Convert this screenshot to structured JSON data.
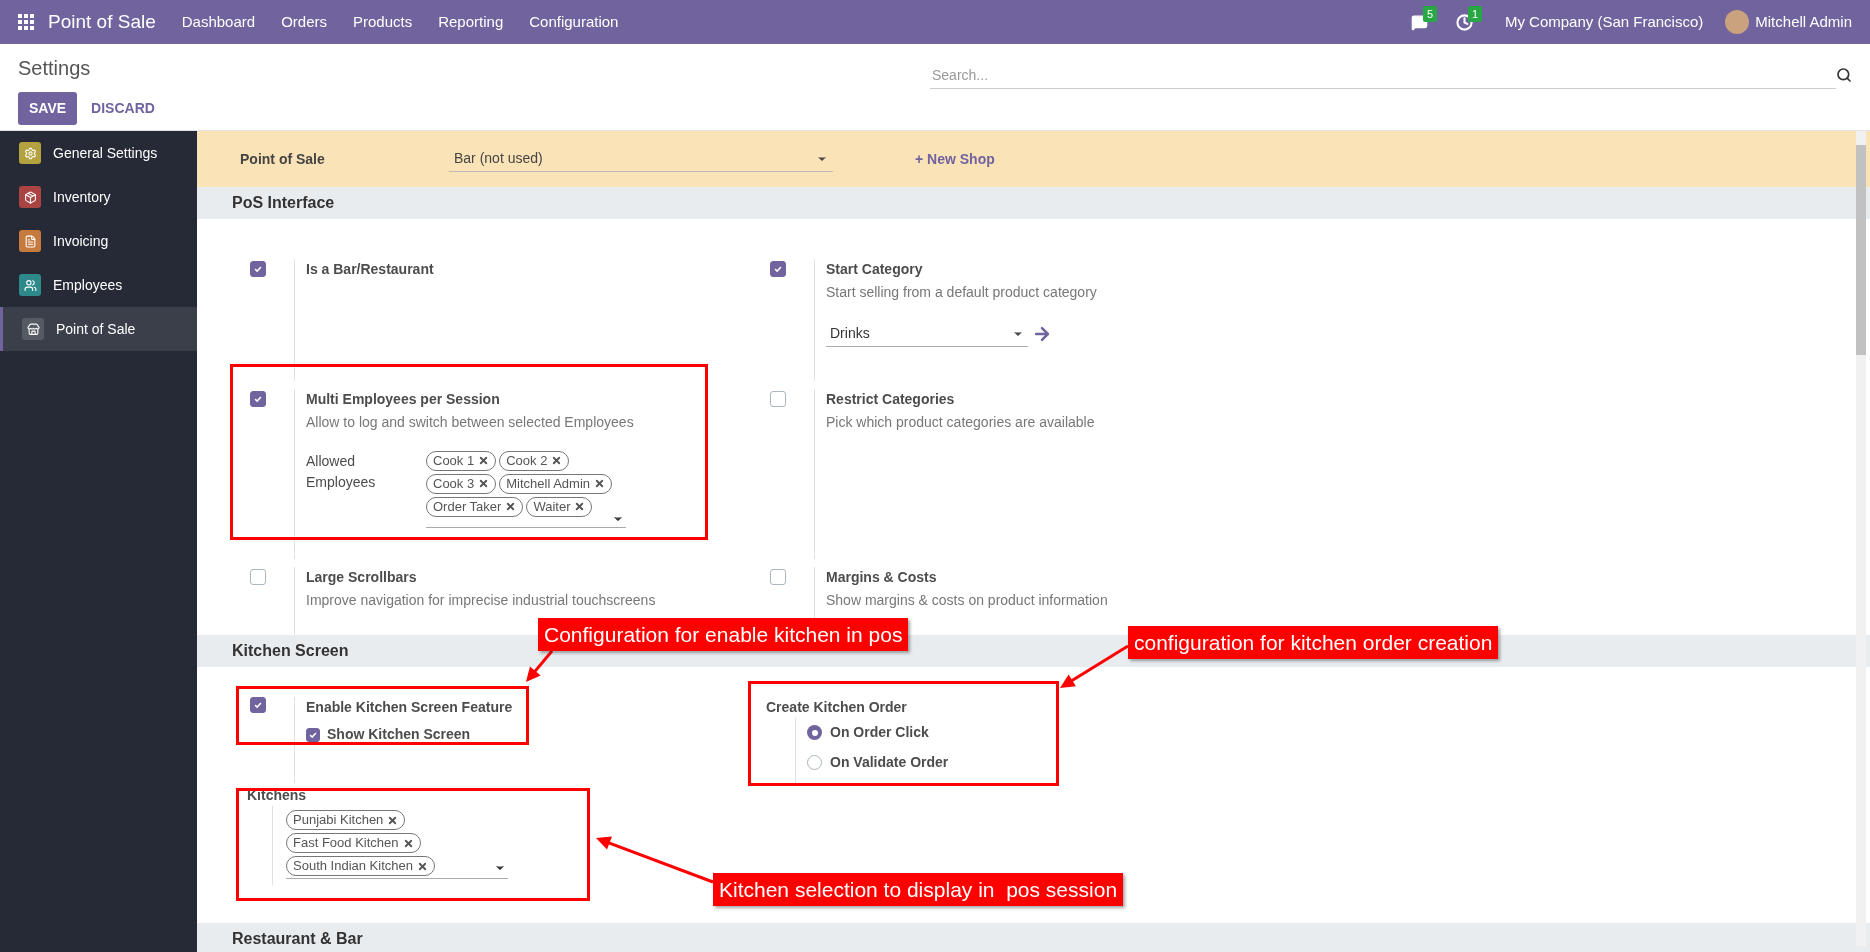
{
  "app": {
    "name": "Point of Sale",
    "menu": [
      "Dashboard",
      "Orders",
      "Products",
      "Reporting",
      "Configuration"
    ],
    "chat_count": "5",
    "activity_count": "1",
    "company": "My Company (San Francisco)",
    "user": "Mitchell Admin"
  },
  "control_panel": {
    "title": "Settings",
    "save": "SAVE",
    "discard": "DISCARD",
    "search": {
      "placeholder": "Search..."
    }
  },
  "sidebar": {
    "items": [
      {
        "label": "General Settings",
        "selected": false,
        "color": "#b3a23f"
      },
      {
        "label": "Inventory",
        "selected": false,
        "color": "#a94442"
      },
      {
        "label": "Invoicing",
        "selected": false,
        "color": "#c77a3d"
      },
      {
        "label": "Employees",
        "selected": false,
        "color": "#2e8a8a"
      },
      {
        "label": "Point of Sale",
        "selected": true,
        "color": "#555b63"
      }
    ]
  },
  "shop_bar": {
    "label": "Point of Sale",
    "value": "Bar (not used)",
    "new_shop": "+ New Shop"
  },
  "pos_interface": {
    "title": "PoS Interface",
    "settings": [
      {
        "title": "Is a Bar/Restaurant",
        "checked": true
      },
      {
        "title": "Start Category",
        "description": "Start selling from a default product category",
        "checked": true,
        "select": "Drinks"
      },
      {
        "title": "Multi Employees per Session",
        "description": "Allow to log and switch between selected Employees",
        "checked": true,
        "field_label": "Allowed Employees",
        "tags": [
          "Cook 1",
          "Cook 2",
          "Cook 3",
          "Mitchell Admin",
          "Order Taker",
          "Waiter"
        ]
      },
      {
        "title": "Restrict Categories",
        "description": "Pick which product categories are available",
        "checked": false
      },
      {
        "title": "Large Scrollbars",
        "description": "Improve navigation for imprecise industrial touchscreens",
        "checked": false
      },
      {
        "title": "Margins & Costs",
        "description": "Show margins & costs on product information",
        "checked": false
      }
    ]
  },
  "kitchen_screen": {
    "title": "Kitchen Screen",
    "enable": {
      "label": "Enable Kitchen Screen Feature",
      "checked": true
    },
    "show": {
      "label": "Show Kitchen Screen",
      "checked": true
    },
    "create_order": {
      "label": "Create Kitchen Order",
      "options": [
        {
          "label": "On Order Click",
          "selected": true
        },
        {
          "label": "On Validate Order",
          "selected": false
        }
      ]
    },
    "kitchens": {
      "label": "Kitchens",
      "tags": [
        "Punjabi Kitchen",
        "Fast Food Kitchen",
        "South Indian Kitchen"
      ]
    }
  },
  "restaurant_bar": {
    "title": "Restaurant & Bar"
  },
  "annotations": [
    "Configuration for enable kitchen in pos",
    "configuration for kitchen order creation",
    "Kitchen selection to display in  pos session"
  ]
}
